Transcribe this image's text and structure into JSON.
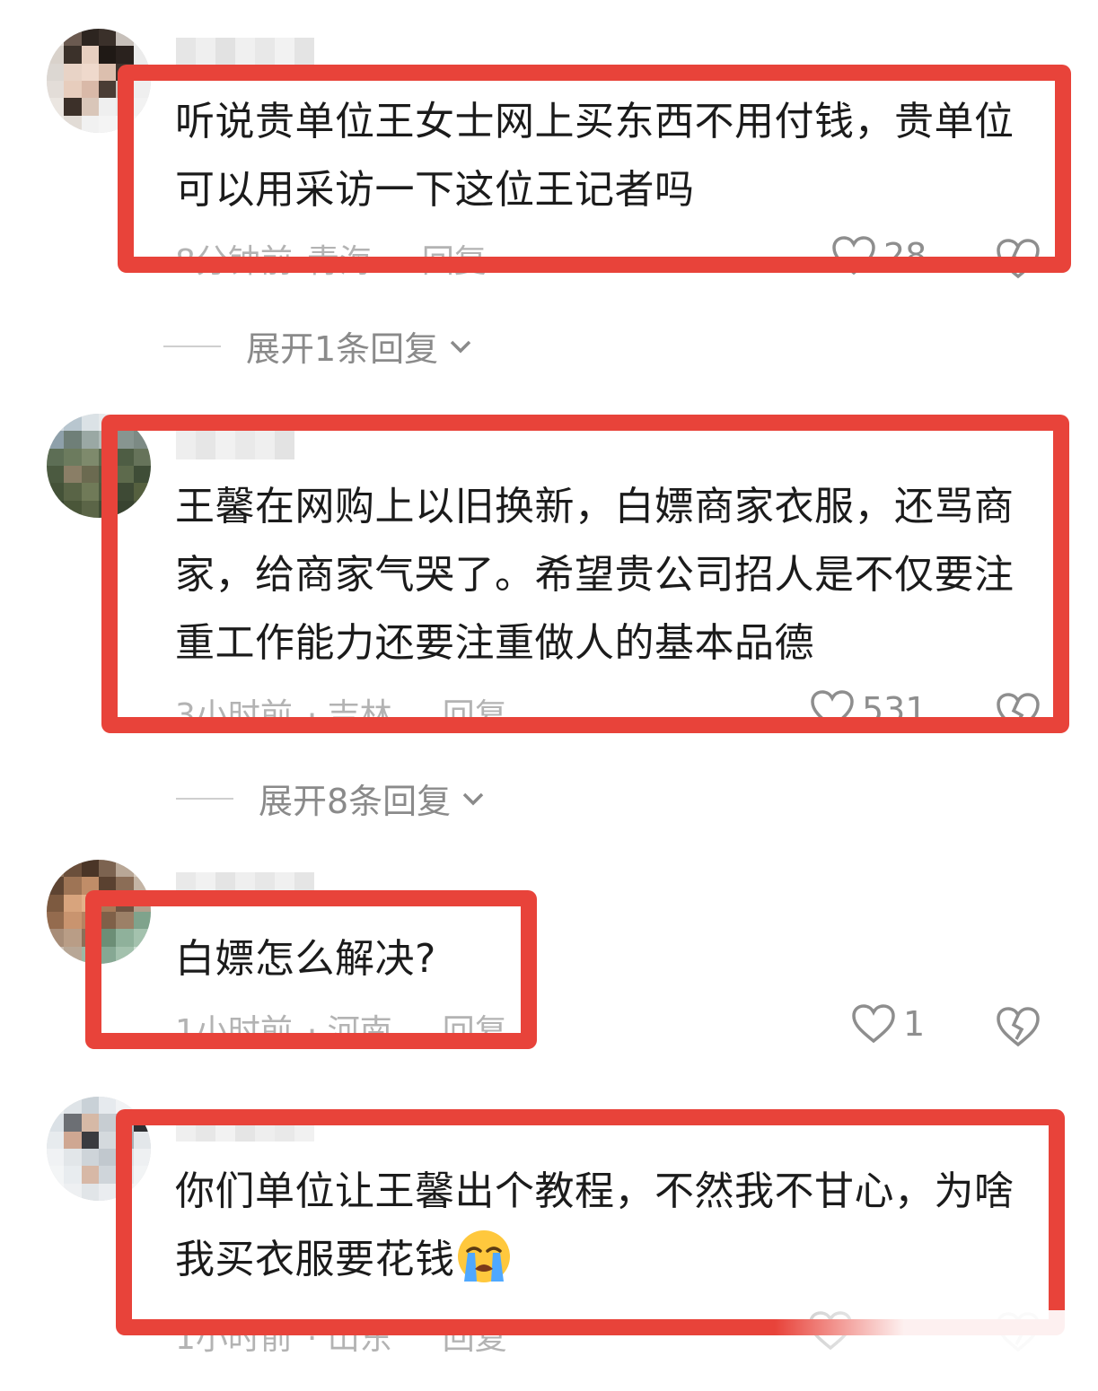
{
  "comments": [
    {
      "text": "听说贵单位王女士网上买东西不用付钱，贵单位可以用采访一下这位王记者吗",
      "time": "8分钟前",
      "location": "青海",
      "reply_label": "回复",
      "likes": "28",
      "expand_label": "展开1条回复"
    },
    {
      "text": "王馨在网购上以旧换新，白嫖商家衣服，还骂商家，给商家气哭了。希望贵公司招人是不仅要注重工作能力还要注重做人的基本品德",
      "time": "3小时前",
      "location": "· 吉林",
      "reply_label": "回复",
      "likes": "531",
      "expand_label": "展开8条回复"
    },
    {
      "text": "白嫖怎么解决?",
      "time": "1小时前",
      "location": "· 河南",
      "reply_label": "回复",
      "likes": "1"
    },
    {
      "text": "你们单位让王馨出个教程，不然我不甘心，为啥我买衣服要花钱",
      "emoji": "loudly-crying-face",
      "time": "1小时前",
      "location": "· 山东",
      "reply_label": "回复"
    }
  ],
  "colors": {
    "highlight_box": "#e8433a",
    "meta_text": "#b3b3b3",
    "body_text": "#1b1b1b"
  },
  "icons": [
    "heart-outline-icon",
    "broken-heart-icon",
    "chevron-down-icon"
  ]
}
